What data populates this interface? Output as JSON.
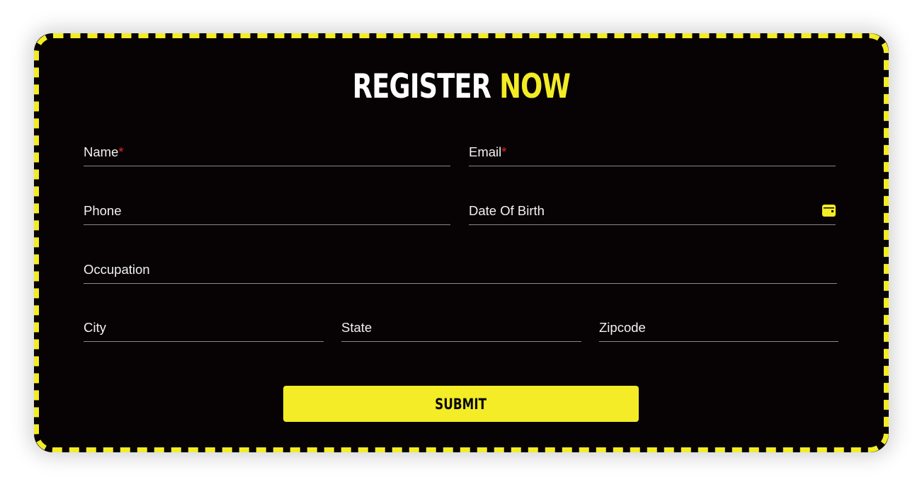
{
  "form": {
    "title_part1": "REGISTER",
    "title_part2": "NOW",
    "required_marker": "*",
    "fields": {
      "name": "Name",
      "email": "Email",
      "phone": "Phone",
      "dob": "Date Of Birth",
      "occupation": "Occupation",
      "city": "City",
      "state": "State",
      "zipcode": "Zipcode"
    },
    "submit_label": "SUBMIT",
    "dob_icon": "calendar-icon"
  },
  "colors": {
    "accent": "#f3ec26",
    "background": "#070203",
    "required": "#e3252b",
    "text": "#f2f2f2",
    "underline": "#8a8a8a"
  }
}
